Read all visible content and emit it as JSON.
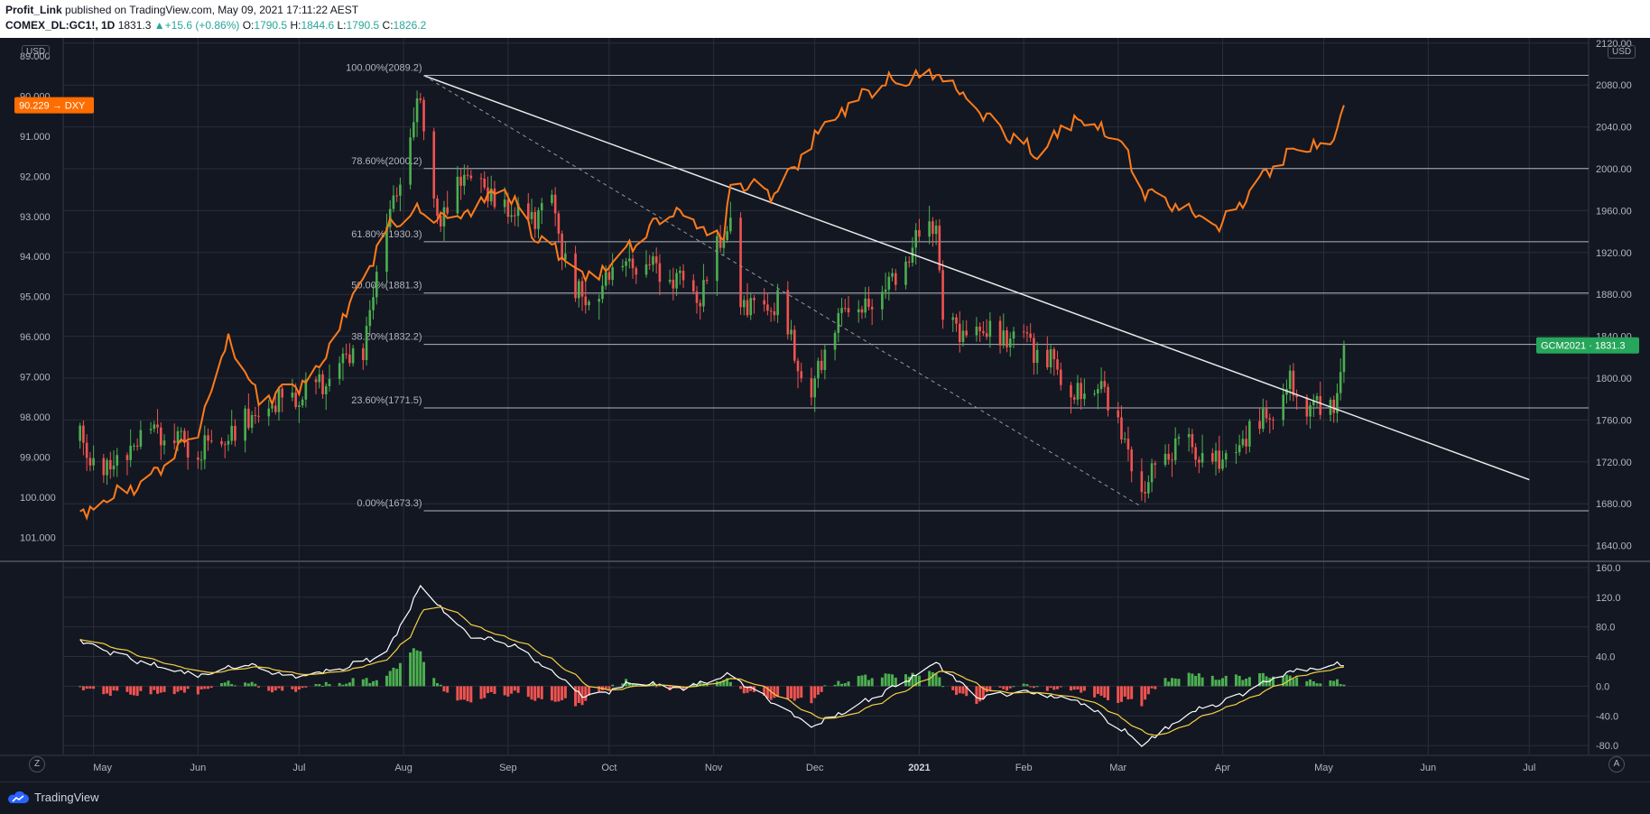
{
  "header": {
    "author": "Profit_Link",
    "published_text": "published on TradingView.com, May 09, 2021 17:11:22 AEST",
    "symbol": "COMEX_DL:GC1!, 1D",
    "last": "1831.3",
    "change": "+15.6 (+0.86%)",
    "o_label": "O:",
    "o_val": "1790.5",
    "h_label": "H:",
    "h_val": "1844.6",
    "l_label": "L:",
    "l_val": "1790.5",
    "c_label": "C:",
    "c_val": "1826.2"
  },
  "badges": {
    "usd_left": "USD",
    "usd_right": "USD",
    "dxy_tag": "90.229 → DXY",
    "gcm_tag": "GCM2021 · 1831.3"
  },
  "footer": {
    "brand": "TradingView",
    "z_btn": "Z",
    "a_btn": "A"
  },
  "colors": {
    "bg": "#131722",
    "grid": "#2a2e39",
    "up": "#4caf50",
    "down": "#ef5350",
    "dxy": "#ff7b1a",
    "fib": "#b2b5be",
    "macd": "#ffffff",
    "signal": "#f5d142",
    "text": "#b2b5be"
  },
  "chart_data": [
    {
      "type": "candlestick",
      "series_name": "COMEX_DL:GC1!",
      "x_ticks": [
        "May",
        "Jun",
        "Jul",
        "Aug",
        "Sep",
        "Oct",
        "Nov",
        "Dec",
        "2021",
        "Feb",
        "Mar",
        "Apr",
        "May",
        "Jun",
        "Jul"
      ],
      "right_axis": {
        "ticks": [
          1640,
          1680,
          1720,
          1760,
          1800,
          1840,
          1880,
          1920,
          1960,
          2000,
          2040,
          2080,
          2120
        ],
        "range": [
          1625,
          2125
        ]
      },
      "left_axis": {
        "ticks": [
          "89.000",
          "90.000",
          "91.000",
          "92.000",
          "93.000",
          "94.000",
          "95.000",
          "96.000",
          "97.000",
          "98.000",
          "99.000",
          "100.000",
          "101.000"
        ],
        "range_inverted": [
          88.55,
          101.6
        ]
      },
      "fib_levels": [
        {
          "label": "100.00%(2089.2)",
          "value": 2089.2
        },
        {
          "label": "78.60%(2000.2)",
          "value": 2000.2
        },
        {
          "label": "61.80%(1930.3)",
          "value": 1930.3
        },
        {
          "label": "50.00%(1881.3)",
          "value": 1881.3
        },
        {
          "label": "38.20%(1832.2)",
          "value": 1832.2
        },
        {
          "label": "23.60%(1771.5)",
          "value": 1771.5
        },
        {
          "label": "0.00%(1673.3)",
          "value": 1673.3
        }
      ],
      "trendline": {
        "from": {
          "date": "2020-08-07",
          "value": 2089
        },
        "to": {
          "date": "2021-07-01",
          "value": 1703
        }
      },
      "dashed_line": {
        "from": {
          "date": "2020-08-07",
          "value": 2089
        },
        "to": {
          "date": "2021-03-08",
          "value": 1677
        }
      },
      "gold_anchors": [
        [
          "2020-04-27",
          1740
        ],
        [
          "2020-05-04",
          1705
        ],
        [
          "2020-05-18",
          1755
        ],
        [
          "2020-06-01",
          1730
        ],
        [
          "2020-06-22",
          1770
        ],
        [
          "2020-07-06",
          1790
        ],
        [
          "2020-07-20",
          1830
        ],
        [
          "2020-07-27",
          1950
        ],
        [
          "2020-08-06",
          2065
        ],
        [
          "2020-08-12",
          1940
        ],
        [
          "2020-08-18",
          2000
        ],
        [
          "2020-08-28",
          1970
        ],
        [
          "2020-09-03",
          1950
        ],
        [
          "2020-09-14",
          1965
        ],
        [
          "2020-09-21",
          1880
        ],
        [
          "2020-09-24",
          1870
        ],
        [
          "2020-10-05",
          1915
        ],
        [
          "2020-10-15",
          1905
        ],
        [
          "2020-10-28",
          1880
        ],
        [
          "2020-11-06",
          1950
        ],
        [
          "2020-11-09",
          1865
        ],
        [
          "2020-11-20",
          1870
        ],
        [
          "2020-11-30",
          1780
        ],
        [
          "2020-12-07",
          1860
        ],
        [
          "2020-12-21",
          1880
        ],
        [
          "2021-01-06",
          1955
        ],
        [
          "2021-01-08",
          1850
        ],
        [
          "2021-01-18",
          1840
        ],
        [
          "2021-02-02",
          1840
        ],
        [
          "2021-02-18",
          1780
        ],
        [
          "2021-02-24",
          1800
        ],
        [
          "2021-03-08",
          1690
        ],
        [
          "2021-03-18",
          1740
        ],
        [
          "2021-03-31",
          1715
        ],
        [
          "2021-04-08",
          1745
        ],
        [
          "2021-04-21",
          1790
        ],
        [
          "2021-04-30",
          1770
        ],
        [
          "2021-05-05",
          1785
        ],
        [
          "2021-05-07",
          1831.3
        ]
      ],
      "dxy_anchors": [
        [
          "2020-04-27",
          100.5
        ],
        [
          "2020-05-18",
          99.5
        ],
        [
          "2020-06-01",
          98.3
        ],
        [
          "2020-06-10",
          96.0
        ],
        [
          "2020-06-19",
          97.6
        ],
        [
          "2020-07-06",
          97.0
        ],
        [
          "2020-07-27",
          93.3
        ],
        [
          "2020-08-03",
          92.9
        ],
        [
          "2020-08-17",
          93.0
        ],
        [
          "2020-08-31",
          92.3
        ],
        [
          "2020-09-08",
          93.4
        ],
        [
          "2020-09-25",
          94.6
        ],
        [
          "2020-10-09",
          93.6
        ],
        [
          "2020-10-20",
          92.8
        ],
        [
          "2020-11-04",
          93.6
        ],
        [
          "2020-11-06",
          92.2
        ],
        [
          "2020-11-20",
          92.4
        ],
        [
          "2020-12-04",
          90.7
        ],
        [
          "2020-12-17",
          89.8
        ],
        [
          "2021-01-06",
          89.4
        ],
        [
          "2021-01-20",
          90.5
        ],
        [
          "2021-02-05",
          91.5
        ],
        [
          "2021-02-16",
          90.5
        ],
        [
          "2021-03-01",
          91.0
        ],
        [
          "2021-03-08",
          92.3
        ],
        [
          "2021-03-31",
          93.3
        ],
        [
          "2021-04-15",
          91.8
        ],
        [
          "2021-04-23",
          91.3
        ],
        [
          "2021-05-04",
          91.1
        ],
        [
          "2021-05-07",
          90.2
        ]
      ],
      "dxy_last": "90.229"
    },
    {
      "type": "macd",
      "y_ticks": [
        160,
        120,
        80,
        40,
        0,
        -40,
        -80
      ],
      "range": [
        -92,
        166
      ],
      "macd_anchors": [
        [
          "2020-04-27",
          60
        ],
        [
          "2020-05-18",
          28
        ],
        [
          "2020-06-01",
          15
        ],
        [
          "2020-06-15",
          30
        ],
        [
          "2020-06-29",
          12
        ],
        [
          "2020-07-13",
          22
        ],
        [
          "2020-07-27",
          45
        ],
        [
          "2020-08-06",
          135
        ],
        [
          "2020-08-20",
          70
        ],
        [
          "2020-09-03",
          55
        ],
        [
          "2020-09-24",
          -15
        ],
        [
          "2020-10-09",
          5
        ],
        [
          "2020-10-23",
          -2
        ],
        [
          "2020-11-06",
          15
        ],
        [
          "2020-11-30",
          -55
        ],
        [
          "2020-12-14",
          -25
        ],
        [
          "2020-12-28",
          8
        ],
        [
          "2021-01-06",
          32
        ],
        [
          "2021-01-18",
          -15
        ],
        [
          "2021-02-01",
          -8
        ],
        [
          "2021-02-18",
          -20
        ],
        [
          "2021-03-08",
          -78
        ],
        [
          "2021-03-23",
          -35
        ],
        [
          "2021-04-01",
          -22
        ],
        [
          "2021-04-21",
          20
        ],
        [
          "2021-05-07",
          30
        ]
      ]
    }
  ]
}
